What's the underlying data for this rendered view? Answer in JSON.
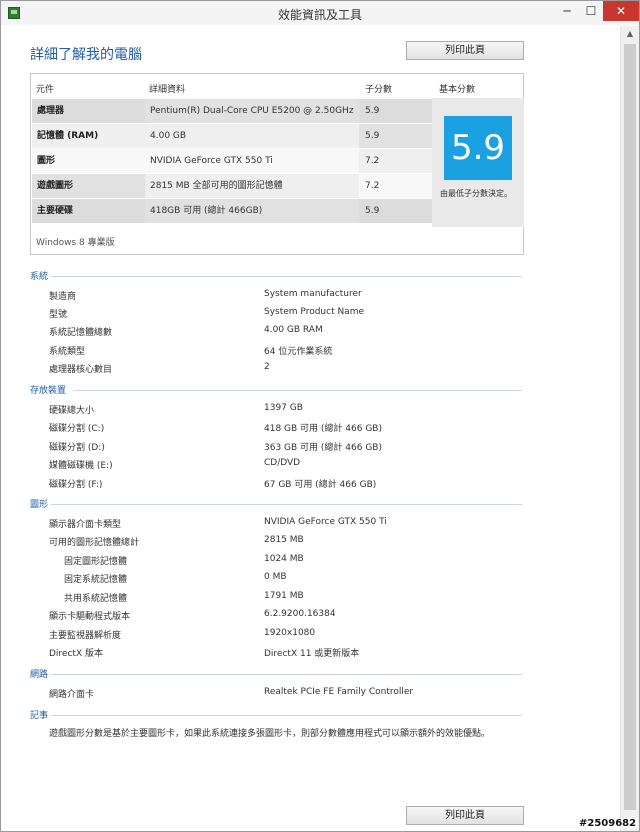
{
  "window": {
    "title": "效能資訊及工具",
    "min_symbol": "─",
    "max_symbol": "☐",
    "close_symbol": "✕",
    "icon": "app-icon"
  },
  "heading": "詳細了解我的電腦",
  "print_label": "列印此頁",
  "scores": {
    "headers": {
      "component": "元件",
      "details": "詳細資料",
      "subscore": "子分數",
      "base": "基本分數"
    },
    "rows": [
      {
        "label": "處理器",
        "detail": "Pentium(R) Dual-Core CPU E5200 @ 2.50GHz",
        "score": "5.9"
      },
      {
        "label": "記憶體 (RAM)",
        "detail": "4.00 GB",
        "score": "5.9"
      },
      {
        "label": "圖形",
        "detail": "NVIDIA GeForce GTX 550 Ti",
        "score": "7.2"
      },
      {
        "label": "遊戲圖形",
        "detail": "2815 MB 全部可用的圖形記憶體",
        "score": "7.2"
      },
      {
        "label": "主要硬碟",
        "detail": "418GB 可用 (總計 466GB)",
        "score": "5.9"
      }
    ],
    "base_score": "5.9",
    "base_note": "由最低子分數決定。",
    "edition": "Windows 8 專業版"
  },
  "sections": {
    "system": {
      "title": "系統",
      "items": [
        {
          "label": "製造商",
          "value": "System manufacturer"
        },
        {
          "label": "型號",
          "value": "System Product Name"
        },
        {
          "label": "系統記憶體總數",
          "value": "4.00 GB RAM"
        },
        {
          "label": "系統類型",
          "value": "64 位元作業系統"
        },
        {
          "label": "處理器核心數目",
          "value": "2"
        }
      ]
    },
    "storage": {
      "title": "存放裝置",
      "items": [
        {
          "label": "硬碟總大小",
          "value": "1397 GB"
        },
        {
          "label": "磁碟分割 (C:)",
          "value": "418 GB 可用 (總計 466 GB)"
        },
        {
          "label": "磁碟分割 (D:)",
          "value": "363 GB 可用 (總計 466 GB)"
        },
        {
          "label": "媒體磁碟機 (E:)",
          "value": "CD/DVD"
        },
        {
          "label": "磁碟分割 (F:)",
          "value": "67 GB 可用 (總計 466 GB)"
        }
      ]
    },
    "graphics": {
      "title": "圖形",
      "items": [
        {
          "label": "顯示器介面卡類型",
          "value": "NVIDIA GeForce GTX 550 Ti"
        },
        {
          "label": "可用的圖形記憶體總計",
          "value": "2815 MB"
        },
        {
          "label": "固定圖形記憶體",
          "value": "1024 MB"
        },
        {
          "label": "固定系統記憶體",
          "value": "0 MB"
        },
        {
          "label": "共用系統記憶體",
          "value": "1791 MB"
        },
        {
          "label": "顯示卡驅動程式版本",
          "value": "6.2.9200.16384"
        },
        {
          "label": "主要監視器解析度",
          "value": "1920x1080"
        },
        {
          "label": "DirectX 版本",
          "value": "DirectX 11 或更新版本"
        }
      ]
    },
    "network": {
      "title": "網路",
      "items": [
        {
          "label": "網路介面卡",
          "value": "Realtek PCIe FE Family Controller"
        }
      ]
    },
    "notes": {
      "title": "記事",
      "text": "遊戲圖形分數是基於主要圖形卡，如果此系統連接多張圖形卡，則部分數體應用程式可以顯示額外的效能優點。"
    }
  },
  "watermark": "#2509682"
}
